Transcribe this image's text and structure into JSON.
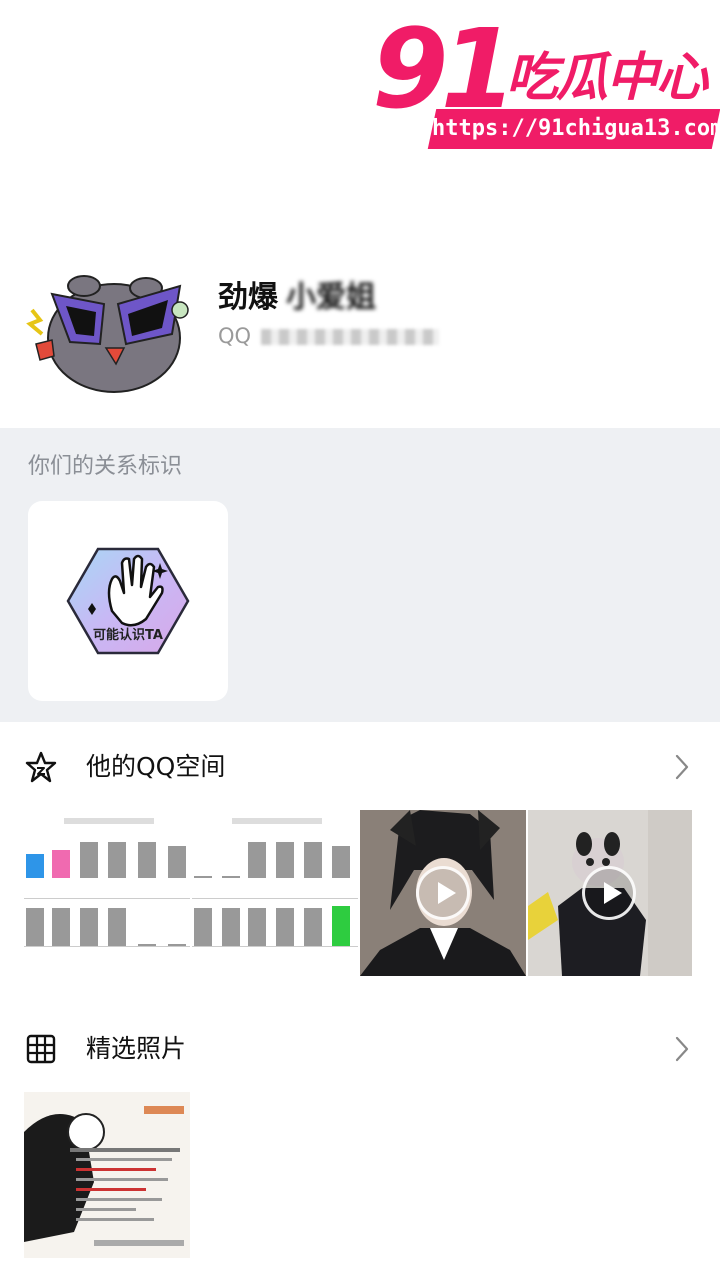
{
  "watermark": {
    "number": "91",
    "brand": "吃瓜中心",
    "url": "https://91chigua13.com"
  },
  "profile": {
    "name": "劲爆",
    "name_obscured": "小爱姐",
    "qq_label": "QQ"
  },
  "relation": {
    "section_title": "你们的关系标识",
    "badge_label": "可能认识TA"
  },
  "qzone": {
    "title": "他的QQ空间",
    "icon": "star-icon",
    "arrow": "chevron-right-icon"
  },
  "selected_photos": {
    "title": "精选照片",
    "icon": "grid-icon",
    "arrow": "chevron-right-icon"
  },
  "colors": {
    "brand": "#f01c67",
    "section_bg": "#eef0f3",
    "muted_text": "#8b8f96",
    "qq_text": "#9a9a9a"
  }
}
